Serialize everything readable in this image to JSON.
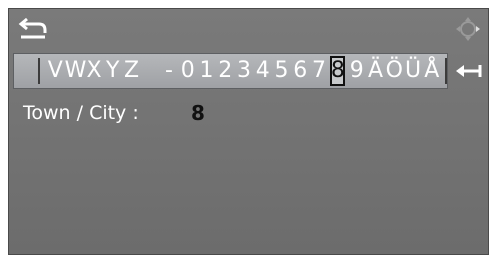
{
  "speller": {
    "characters": [
      "V",
      "W",
      "X",
      "Y",
      "Z",
      " ",
      "-",
      "0",
      "1",
      "2",
      "3",
      "4",
      "5",
      "6",
      "7",
      "8",
      "9",
      "Ä",
      "Ö",
      "Ü",
      "Å"
    ],
    "selected_char": "8"
  },
  "destination": {
    "field_label": "Town / City :",
    "field_value": "8"
  },
  "icons": {
    "back": "back-arrow-icon",
    "controller": "controller-icon",
    "delete": "delete-arrow-icon"
  },
  "colors": {
    "screen_bg": "#737373",
    "speller_bg": "#aaacaf",
    "text": "#ffffff",
    "value_text": "#111111"
  }
}
